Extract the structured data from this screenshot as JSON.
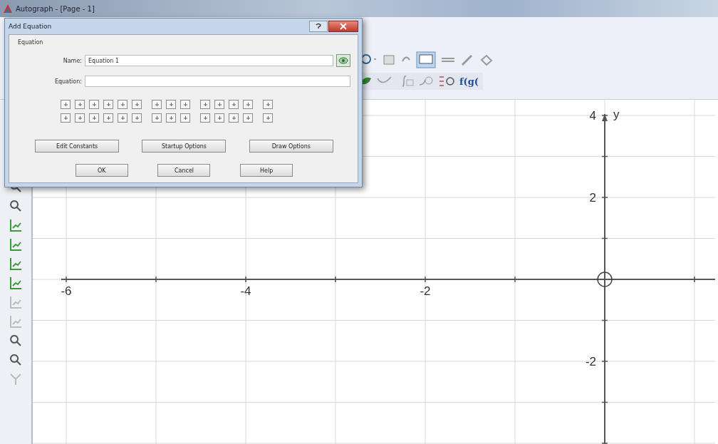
{
  "window": {
    "title": "Autograph - [Page - 1]"
  },
  "toolbar": {
    "function_label": "f(g("
  },
  "dialog": {
    "title": "Add Equation",
    "group_label": "Equation",
    "name_label": "Name:",
    "name_value": "Equation 1",
    "equation_label": "Equation:",
    "option_buttons": [
      "Edit Constants",
      "Startup Options",
      "Draw Options"
    ],
    "action_buttons": [
      "OK",
      "Cancel",
      "Help"
    ]
  },
  "graph": {
    "axis_label": "y",
    "x_tick_labels": [
      "-6",
      "-4",
      "-2"
    ],
    "y_tick_labels": [
      "4",
      "2",
      "-2"
    ]
  }
}
